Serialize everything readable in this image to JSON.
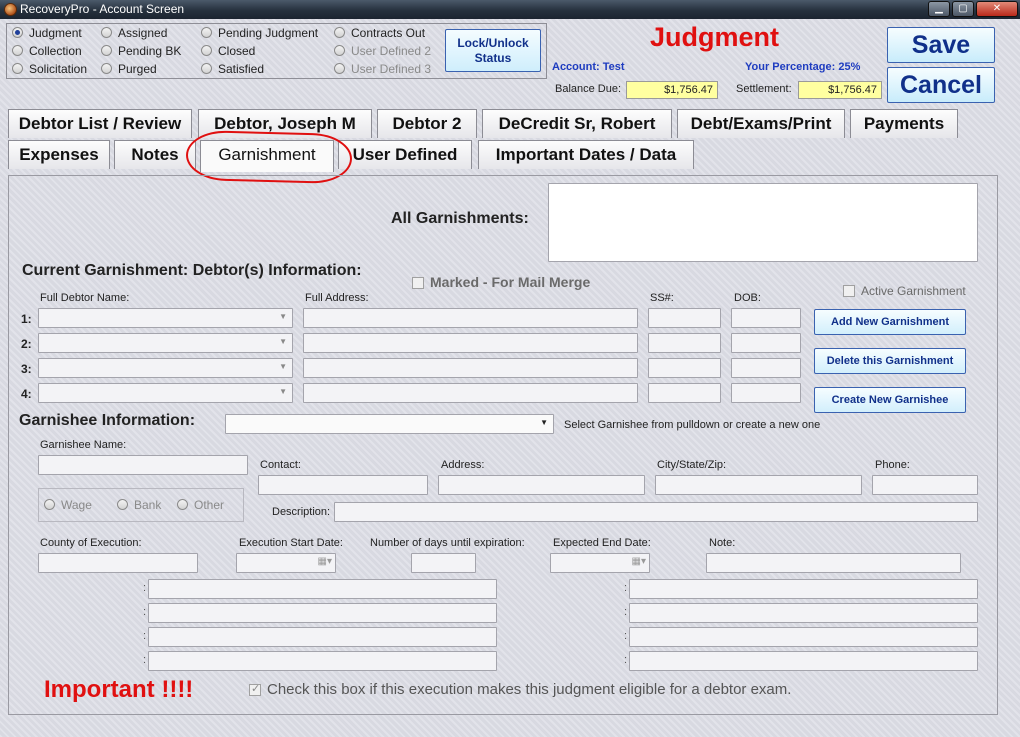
{
  "window": {
    "title": "RecoveryPro - Account Screen",
    "minimize_icon": "minimize-icon",
    "maximize_icon": "maximize-icon",
    "close_icon": "close-icon"
  },
  "status_radios": [
    {
      "label": "Judgment",
      "selected": true,
      "enabled": true
    },
    {
      "label": "Collection",
      "selected": false,
      "enabled": true
    },
    {
      "label": "Solicitation",
      "selected": false,
      "enabled": true
    },
    {
      "label": "Assigned",
      "selected": false,
      "enabled": true
    },
    {
      "label": "Pending BK",
      "selected": false,
      "enabled": true
    },
    {
      "label": "Purged",
      "selected": false,
      "enabled": true
    },
    {
      "label": "Pending Judgment",
      "selected": false,
      "enabled": true
    },
    {
      "label": "Closed",
      "selected": false,
      "enabled": true
    },
    {
      "label": "Satisfied",
      "selected": false,
      "enabled": true
    },
    {
      "label": "Contracts Out",
      "selected": false,
      "enabled": true
    },
    {
      "label": "User Defined 2",
      "selected": false,
      "enabled": false
    },
    {
      "label": "User Defined 3",
      "selected": false,
      "enabled": false
    }
  ],
  "lock_button": {
    "line1": "Lock/Unlock",
    "line2": "Status"
  },
  "header": {
    "status_title": "Judgment",
    "account_label": "Account:",
    "account_value": "Test",
    "percentage_label": "Your Percentage:",
    "percentage_value": "25%",
    "balance_label": "Balance Due:",
    "balance_value": "$1,756.47",
    "settlement_label": "Settlement:",
    "settlement_value": "$1,756.47",
    "save_label": "Save",
    "cancel_label": "Cancel"
  },
  "tabs_row1": [
    "Debtor List / Review",
    "Debtor, Joseph M",
    "Debtor 2",
    "DeCredit Sr, Robert",
    "Debt/Exams/Print",
    "Payments"
  ],
  "tabs_row2": [
    "Expenses",
    "Notes",
    "Garnishment",
    "User Defined",
    "Important Dates / Data"
  ],
  "active_tab": "Garnishment",
  "garnishment": {
    "all_garnishments_label": "All Garnishments:",
    "current_label": "Current Garnishment:  Debtor(s) Information:",
    "marked_label": "Marked - For Mail Merge",
    "active_label": "Active Garnishment",
    "full_name_label": "Full Debtor Name:",
    "full_address_label": "Full Address:",
    "ssn_label": "SS#:",
    "dob_label": "DOB:",
    "row_labels": [
      "1:",
      "2:",
      "3:",
      "4:"
    ],
    "add_button": "Add New Garnishment",
    "delete_button": "Delete this Garnishment",
    "create_button": "Create New Garnishee",
    "garnishee_info_label": "Garnishee Information:",
    "select_hint": "Select Garnishee from pulldown or create a new one",
    "garnishee_name_label": "Garnishee Name:",
    "contact_label": "Contact:",
    "address_label": "Address:",
    "city_label": "City/State/Zip:",
    "phone_label": "Phone:",
    "wage_label": "Wage",
    "bank_label": "Bank",
    "other_label": "Other",
    "description_label": "Description:",
    "county_label": "County of Execution:",
    "exec_start_label": "Execution Start Date:",
    "days_label": "Number of days until expiration:",
    "expected_end_label": "Expected End Date:",
    "note_label": "Note:",
    "important_label": "Important !!!!",
    "exam_check_label": "Check this box if this execution makes this judgment eligible for a debtor exam."
  }
}
